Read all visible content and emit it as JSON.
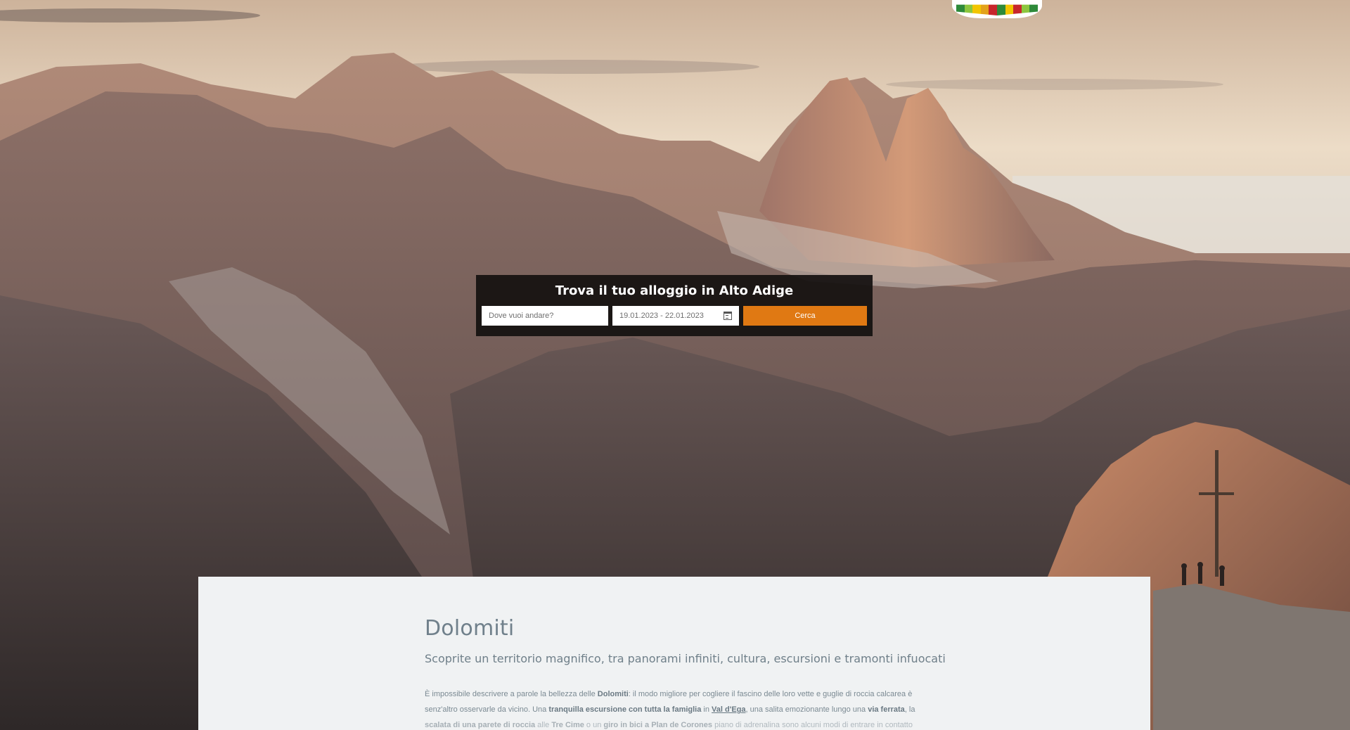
{
  "colors": {
    "accent": "#e07913",
    "search_panel": "#141110",
    "card_bg": "#f0f2f3",
    "title_text": "#70808b"
  },
  "logo": {
    "stripes": [
      "#2e8a3a",
      "#8cc63f",
      "#f2c500",
      "#e3a21a",
      "#c7262c",
      "#2e8a3a",
      "#f2c500",
      "#c7262c",
      "#8cc63f",
      "#2e8a3a"
    ]
  },
  "search": {
    "title": "Trova il tuo alloggio in Alto Adige",
    "where_placeholder": "Dove vuoi andare?",
    "date_value": "19.01.2023 - 22.01.2023",
    "calendar_icon": "calendar-icon",
    "button_label": "Cerca"
  },
  "content": {
    "title": "Dolomiti",
    "subtitle": "Scoprite un territorio magnifico, tra panorami infiniti, cultura, escursioni e tramonti infuocati",
    "body": {
      "p1_a": "È impossibile descrivere a parole la bellezza delle ",
      "p1_b": "Dolomiti",
      "p1_c": ": il modo migliore per cogliere il fascino delle loro vette e guglie di roccia calcarea è senz'altro osservarle da vicino. Una ",
      "p1_d": "tranquilla escursione con tutta la famiglia",
      "p1_e": " in ",
      "p1_f": "Val d'Ega",
      "p1_g": ", una salita emozionante lungo una ",
      "p1_h": "via ferrata",
      "p1_i": ", la ",
      "p1_j": "scalata di una parete di roccia",
      "p1_k": " alle ",
      "p1_l": "Tre Cime",
      "p1_m": " o un ",
      "p1_n": "giro in bici a Plan de Corones",
      "p1_o": " piano di adrenalina sono alcuni modi di entrare in contatto"
    }
  }
}
